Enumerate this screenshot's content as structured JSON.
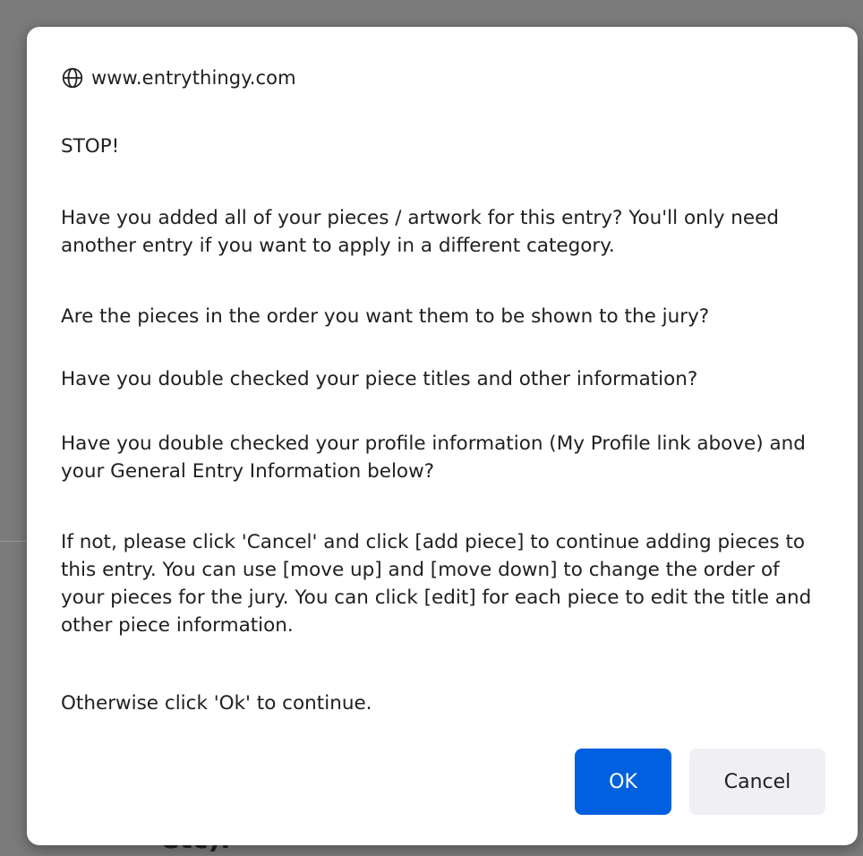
{
  "dialog": {
    "origin": "www.entrythingy.com",
    "origin_icon": "globe-icon",
    "messages": [
      "STOP!",
      "Have you added all of your pieces / artwork for this entry? You'll only need another entry if you want to apply in a different category.",
      "Are the pieces in the order you want them to be shown to the jury?",
      "Have you double checked your piece titles and other information?",
      "Have you double checked your profile information (My Profile link above) and your General Entry Information below?",
      "If not, please click 'Cancel' and click [add piece] to continue adding pieces to this entry. You can use [move up] and [move down] to change the order of your pieces for the jury. You can click [edit] for each piece to edit the title and other piece information.",
      "Otherwise click 'Ok' to continue."
    ],
    "ok_label": "OK",
    "cancel_label": "Cancel"
  },
  "background": {
    "partial_text": "etc)."
  },
  "colors": {
    "primary": "#0060df",
    "secondary_button": "#f0f0f4",
    "backdrop": "#7b7b7b"
  }
}
